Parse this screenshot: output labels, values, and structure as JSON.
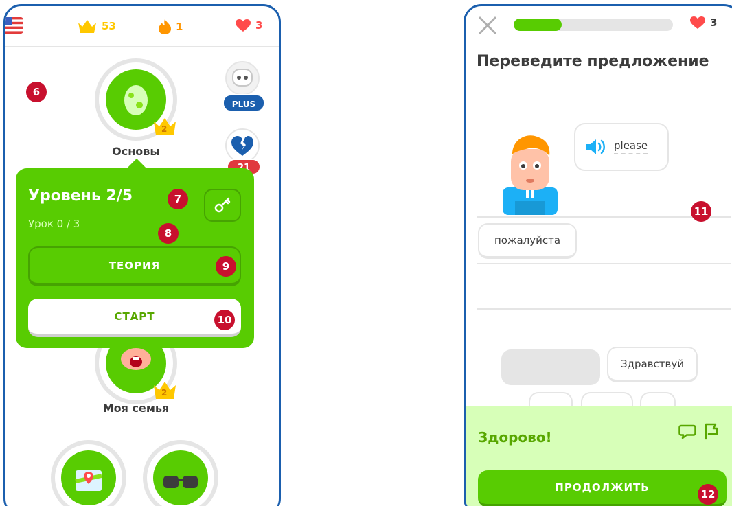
{
  "left_screen": {
    "stats": {
      "crowns": "53",
      "streak": "1",
      "hearts": "3"
    },
    "skills": [
      {
        "name": "Основы",
        "crown_level": "2"
      },
      {
        "name": "Моя семья",
        "crown_level": "2"
      }
    ],
    "plus_label": "PLUS",
    "broken_hearts_count": "21",
    "popup": {
      "title": "Уровень 2/5",
      "subtitle": "Урок 0 / 3",
      "theory_button": "ТЕОРИЯ",
      "start_button": "СТАРТ"
    },
    "callouts": [
      "6",
      "7",
      "8",
      "9",
      "10"
    ]
  },
  "right_screen": {
    "progress": 0.3,
    "hearts": "3",
    "prompt": "Переведите предложение",
    "speech_word": "please",
    "answer_chip": "пожалуйста",
    "word_bank": [
      "Здравствуй"
    ],
    "feedback_title": "Здорово!",
    "continue_button": "ПРОДОЛЖИТЬ",
    "callouts": [
      "11",
      "12"
    ]
  },
  "colors": {
    "frame": "#1b5fae",
    "primary_green": "#58cc02",
    "badge_red": "#c8102e",
    "heart_red": "#ff4b4b",
    "crown_gold": "#ffc800"
  }
}
